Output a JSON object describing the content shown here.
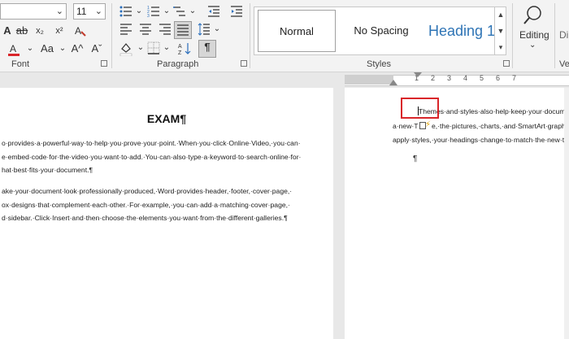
{
  "ribbon": {
    "font_size": "11",
    "font_group_label": "Font",
    "paragraph_group_label": "Paragraph",
    "styles_group_label": "Styles",
    "styles": {
      "normal": "Normal",
      "no_spacing": "No Spacing",
      "heading1": "Heading 1"
    },
    "editing_label": "Editing",
    "dictate_label_partial": "Di",
    "ve_label_partial": "Ve",
    "icons": {
      "bold": "A",
      "clear_format": "A",
      "superscript": "x²",
      "subscript": "x₂",
      "font_color": "A",
      "change_case": "Aa",
      "grow_font": "A^",
      "shrink_font": "Aˇ",
      "pilcrow": "¶",
      "sort": "↓A"
    }
  },
  "ruler": {
    "numbers": [
      "1",
      "2",
      "3",
      "4",
      "5",
      "6",
      "7"
    ]
  },
  "document": {
    "left_page": {
      "title": "EXAM¶",
      "lines": [
        "o·provides·a·powerful·way·to·help·you·prove·your·point.·When·you·click·Online·Video,·you·can·",
        "e·embed·code·for·the·video·you·want·to·add.·You·can·also·type·a·keyword·to·search·online·for·",
        "hat·best·fits·your·document.¶",
        "ake·your·document·look·professionally·produced,·Word·provides·header,·footer,·cover·page,·",
        "ox·designs·that·complement·each·other.·For·example,·you·can·add·a·matching·cover·page,·",
        "d·sidebar.·Click·Insert·and·then·choose·the·elements·you·want·from·the·different·galleries.¶"
      ]
    },
    "right_page": {
      "line1": "Themes·and·styles·also·help·keep·your·documen",
      "line2_start": "a·new·T",
      "line2_end": "e,·the·pictures,·charts,·and·SmartArt·graphi",
      "line3": "apply·styles,·your·headings·change·to·match·the·new·the",
      "para_mark": "¶"
    }
  },
  "colors": {
    "highlight_border": "#d9262a",
    "heading_blue": "#2e74b5",
    "font_color_red": "#d9262a"
  }
}
